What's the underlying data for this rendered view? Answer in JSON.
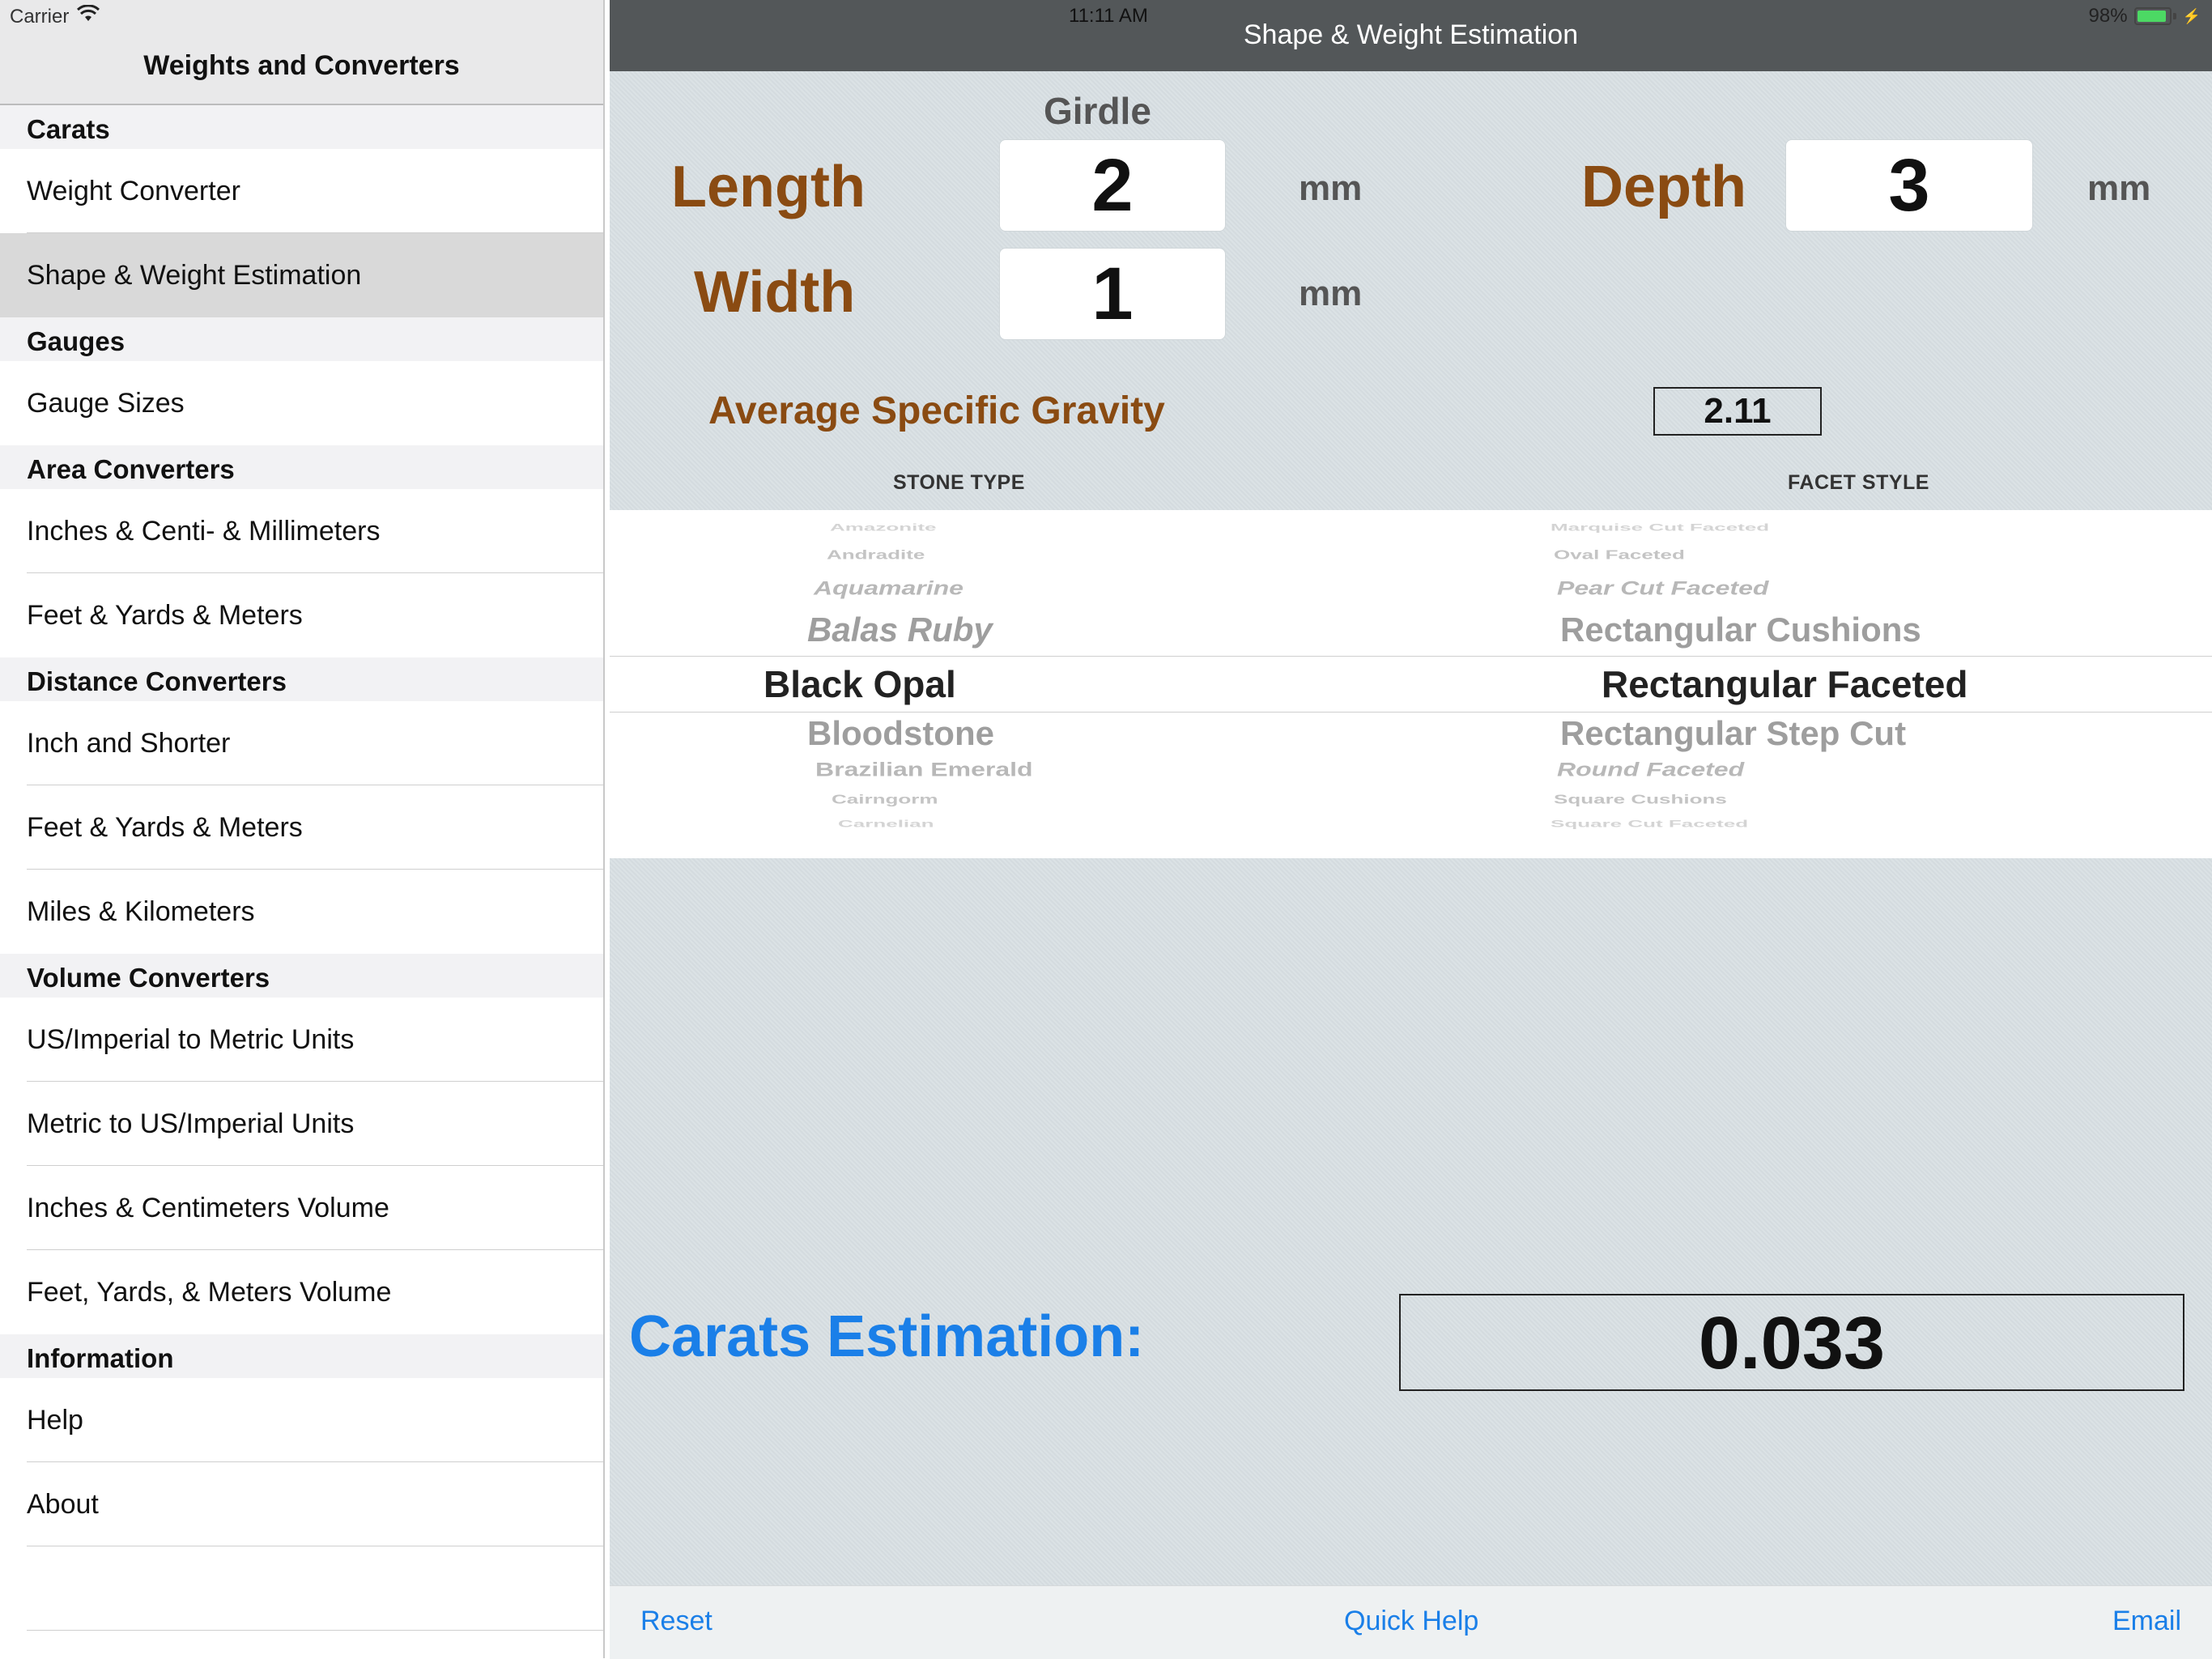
{
  "status": {
    "carrier": "Carrier",
    "time": "11:11 AM",
    "battery": "98%"
  },
  "sidebar": {
    "title": "Weights and Converters",
    "sections": {
      "carats": "Carats",
      "gauges": "Gauges",
      "area": "Area Converters",
      "distance": "Distance Converters",
      "volume": "Volume Converters",
      "information": "Information"
    },
    "items": {
      "weight_converter": "Weight Converter",
      "shape_weight": "Shape & Weight Estimation",
      "gauge_sizes": "Gauge Sizes",
      "area_inches": "Inches & Centi- & Millimeters",
      "area_feet": "Feet & Yards & Meters",
      "inch_shorter": "Inch and Shorter",
      "dist_feet": "Feet & Yards & Meters",
      "miles_km": "Miles & Kilometers",
      "us_metric": "US/Imperial to Metric Units",
      "metric_us": "Metric to US/Imperial Units",
      "inches_cm_vol": "Inches & Centimeters Volume",
      "feet_vol": "Feet, Yards, & Meters Volume",
      "help": "Help",
      "about": "About"
    }
  },
  "main": {
    "title": "Shape & Weight Estimation",
    "girdle_label": "Girdle",
    "length_label": "Length",
    "width_label": "Width",
    "depth_label": "Depth",
    "length_value": "2",
    "width_value": "1",
    "depth_value": "3",
    "unit": "mm",
    "sg_label": "Average Specific Gravity",
    "sg_value": "2.11",
    "stone_type_header": "STONE TYPE",
    "facet_style_header": "FACET STYLE",
    "stone_types": {
      "m3": "Amazonite",
      "m2": "Andradite",
      "m1a": "Aquamarine",
      "m1b": "Balas Ruby",
      "selected": "Black Opal",
      "p1a": "Bloodstone",
      "p1b": "Brazilian Emerald",
      "p2": "Cairngorm",
      "p3": "Carnelian"
    },
    "facet_styles": {
      "m3": "Marquise Cut Faceted",
      "m2": "Oval Faceted",
      "m1a": "Pear Cut Faceted",
      "m1b": "Rectangular Cushions",
      "selected": "Rectangular Faceted",
      "p1a": "Rectangular Step Cut",
      "p1b": "Round Faceted",
      "p2": "Square Cushions",
      "p3": "Square Cut Faceted"
    },
    "carats_label": "Carats Estimation:",
    "carats_value": "0.033"
  },
  "toolbar": {
    "reset": "Reset",
    "quick_help": "Quick Help",
    "email": "Email"
  },
  "colors": {
    "accent": "#1a7fe8",
    "label_brown": "#8a4b12",
    "navbar": "#535759"
  }
}
